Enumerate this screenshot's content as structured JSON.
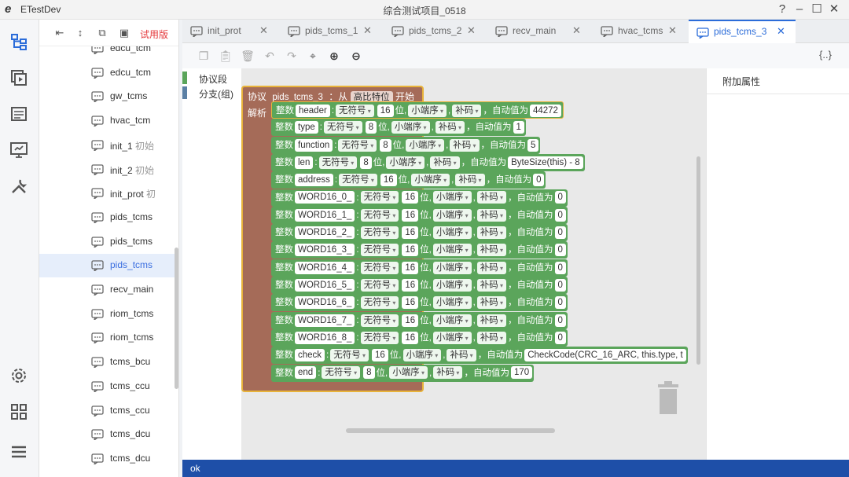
{
  "app": {
    "logo": "e",
    "name": "ETestDev",
    "window_title": "综合测试项目_0518",
    "help": "?",
    "minimize": "–",
    "maximize": "☐",
    "close": "✕"
  },
  "tree": {
    "trial_label": "试用版",
    "items": [
      {
        "label": "edcu_tcm",
        "ext": ""
      },
      {
        "label": "edcu_tcm",
        "ext": ""
      },
      {
        "label": "gw_tcms",
        "ext": ""
      },
      {
        "label": "hvac_tcm",
        "ext": ""
      },
      {
        "label": "init_1",
        "ext": " 初始"
      },
      {
        "label": "init_2",
        "ext": " 初始"
      },
      {
        "label": "init_prot",
        "ext": " 初"
      },
      {
        "label": "pids_tcms",
        "ext": ""
      },
      {
        "label": "pids_tcms",
        "ext": ""
      },
      {
        "label": "pids_tcms",
        "ext": ""
      },
      {
        "label": "recv_main",
        "ext": ""
      },
      {
        "label": "riom_tcms",
        "ext": ""
      },
      {
        "label": "riom_tcms",
        "ext": ""
      },
      {
        "label": "tcms_bcu",
        "ext": ""
      },
      {
        "label": "tcms_ccu",
        "ext": ""
      },
      {
        "label": "tcms_ccu",
        "ext": ""
      },
      {
        "label": "tcms_dcu",
        "ext": ""
      },
      {
        "label": "tcms_dcu",
        "ext": ""
      }
    ],
    "selected_index": 9
  },
  "tabs": [
    {
      "label": "init_prot",
      "close": "✕"
    },
    {
      "label": "pids_tcms_1",
      "close": "✕"
    },
    {
      "label": "pids_tcms_2",
      "close": "✕"
    },
    {
      "label": "recv_main",
      "close": "✕"
    },
    {
      "label": "hvac_tcms",
      "close": "✕"
    },
    {
      "label": "pids_tcms_3",
      "close": "✕"
    }
  ],
  "active_tab": 5,
  "toolbar": {
    "braces": "{..}"
  },
  "categories": [
    {
      "label": "协议段",
      "color": "#5ba55b"
    },
    {
      "label": "分支(组)",
      "color": "#5b80a5"
    }
  ],
  "protocol": {
    "kw": "协议",
    "name": "pids_tcms_3",
    "from": "：从",
    "endian": "高比特位",
    "start": "开始",
    "parse": "解析"
  },
  "fields": [
    {
      "kw": "整数",
      "name": "header",
      "sign": "无符号",
      "bits": "16",
      "bits_unit": "位,",
      "order": "小端序",
      "code": "补码",
      "auto": "，自动值为",
      "value": "44272"
    },
    {
      "kw": "整数",
      "name": "type",
      "sign": "无符号",
      "bits": "8",
      "bits_unit": "位,",
      "order": "小端序",
      "code": "补码",
      "auto": "，自动值为",
      "value": "1"
    },
    {
      "kw": "整数",
      "name": "function",
      "sign": "无符号",
      "bits": "8",
      "bits_unit": "位,",
      "order": "小端序",
      "code": "补码",
      "auto": "，自动值为",
      "value": "5"
    },
    {
      "kw": "整数",
      "name": "len",
      "sign": "无符号",
      "bits": "8",
      "bits_unit": "位,",
      "order": "小端序",
      "code": "补码",
      "auto": "，自动值为",
      "value": "ByteSize(this) - 8"
    },
    {
      "kw": "整数",
      "name": "address",
      "sign": "无符号",
      "bits": "16",
      "bits_unit": "位,",
      "order": "小端序",
      "code": "补码",
      "auto": "，自动值为",
      "value": "0"
    },
    {
      "kw": "整数",
      "name": "WORD16_0_",
      "sign": "无符号",
      "bits": "16",
      "bits_unit": "位,",
      "order": "小端序",
      "code": "补码",
      "auto": "，自动值为",
      "value": "0"
    },
    {
      "kw": "整数",
      "name": "WORD16_1_",
      "sign": "无符号",
      "bits": "16",
      "bits_unit": "位,",
      "order": "小端序",
      "code": "补码",
      "auto": "，自动值为",
      "value": "0"
    },
    {
      "kw": "整数",
      "name": "WORD16_2_",
      "sign": "无符号",
      "bits": "16",
      "bits_unit": "位,",
      "order": "小端序",
      "code": "补码",
      "auto": "，自动值为",
      "value": "0"
    },
    {
      "kw": "整数",
      "name": "WORD16_3_",
      "sign": "无符号",
      "bits": "16",
      "bits_unit": "位,",
      "order": "小端序",
      "code": "补码",
      "auto": "，自动值为",
      "value": "0"
    },
    {
      "kw": "整数",
      "name": "WORD16_4_",
      "sign": "无符号",
      "bits": "16",
      "bits_unit": "位,",
      "order": "小端序",
      "code": "补码",
      "auto": "，自动值为",
      "value": "0"
    },
    {
      "kw": "整数",
      "name": "WORD16_5_",
      "sign": "无符号",
      "bits": "16",
      "bits_unit": "位,",
      "order": "小端序",
      "code": "补码",
      "auto": "，自动值为",
      "value": "0"
    },
    {
      "kw": "整数",
      "name": "WORD16_6_",
      "sign": "无符号",
      "bits": "16",
      "bits_unit": "位,",
      "order": "小端序",
      "code": "补码",
      "auto": "，自动值为",
      "value": "0"
    },
    {
      "kw": "整数",
      "name": "WORD16_7_",
      "sign": "无符号",
      "bits": "16",
      "bits_unit": "位,",
      "order": "小端序",
      "code": "补码",
      "auto": "，自动值为",
      "value": "0"
    },
    {
      "kw": "整数",
      "name": "WORD16_8_",
      "sign": "无符号",
      "bits": "16",
      "bits_unit": "位,",
      "order": "小端序",
      "code": "补码",
      "auto": "，自动值为",
      "value": "0"
    },
    {
      "kw": "整数",
      "name": "check",
      "sign": "无符号",
      "bits": "16",
      "bits_unit": "位,",
      "order": "小端序",
      "code": "补码",
      "auto": "，自动值为",
      "value": "CheckCode(CRC_16_ARC, this.type, t"
    },
    {
      "kw": "整数",
      "name": "end",
      "sign": "无符号",
      "bits": "8",
      "bits_unit": "位,",
      "order": "小端序",
      "code": "补码",
      "auto": "，自动值为",
      "value": "170"
    }
  ],
  "props": {
    "title": "附加属性"
  },
  "status": {
    "text": "ok"
  },
  "colors": {
    "accent": "#2b6cd9",
    "block_green": "#5ba55b",
    "block_brown": "#a56b58",
    "status_bar": "#1e4fa8"
  }
}
